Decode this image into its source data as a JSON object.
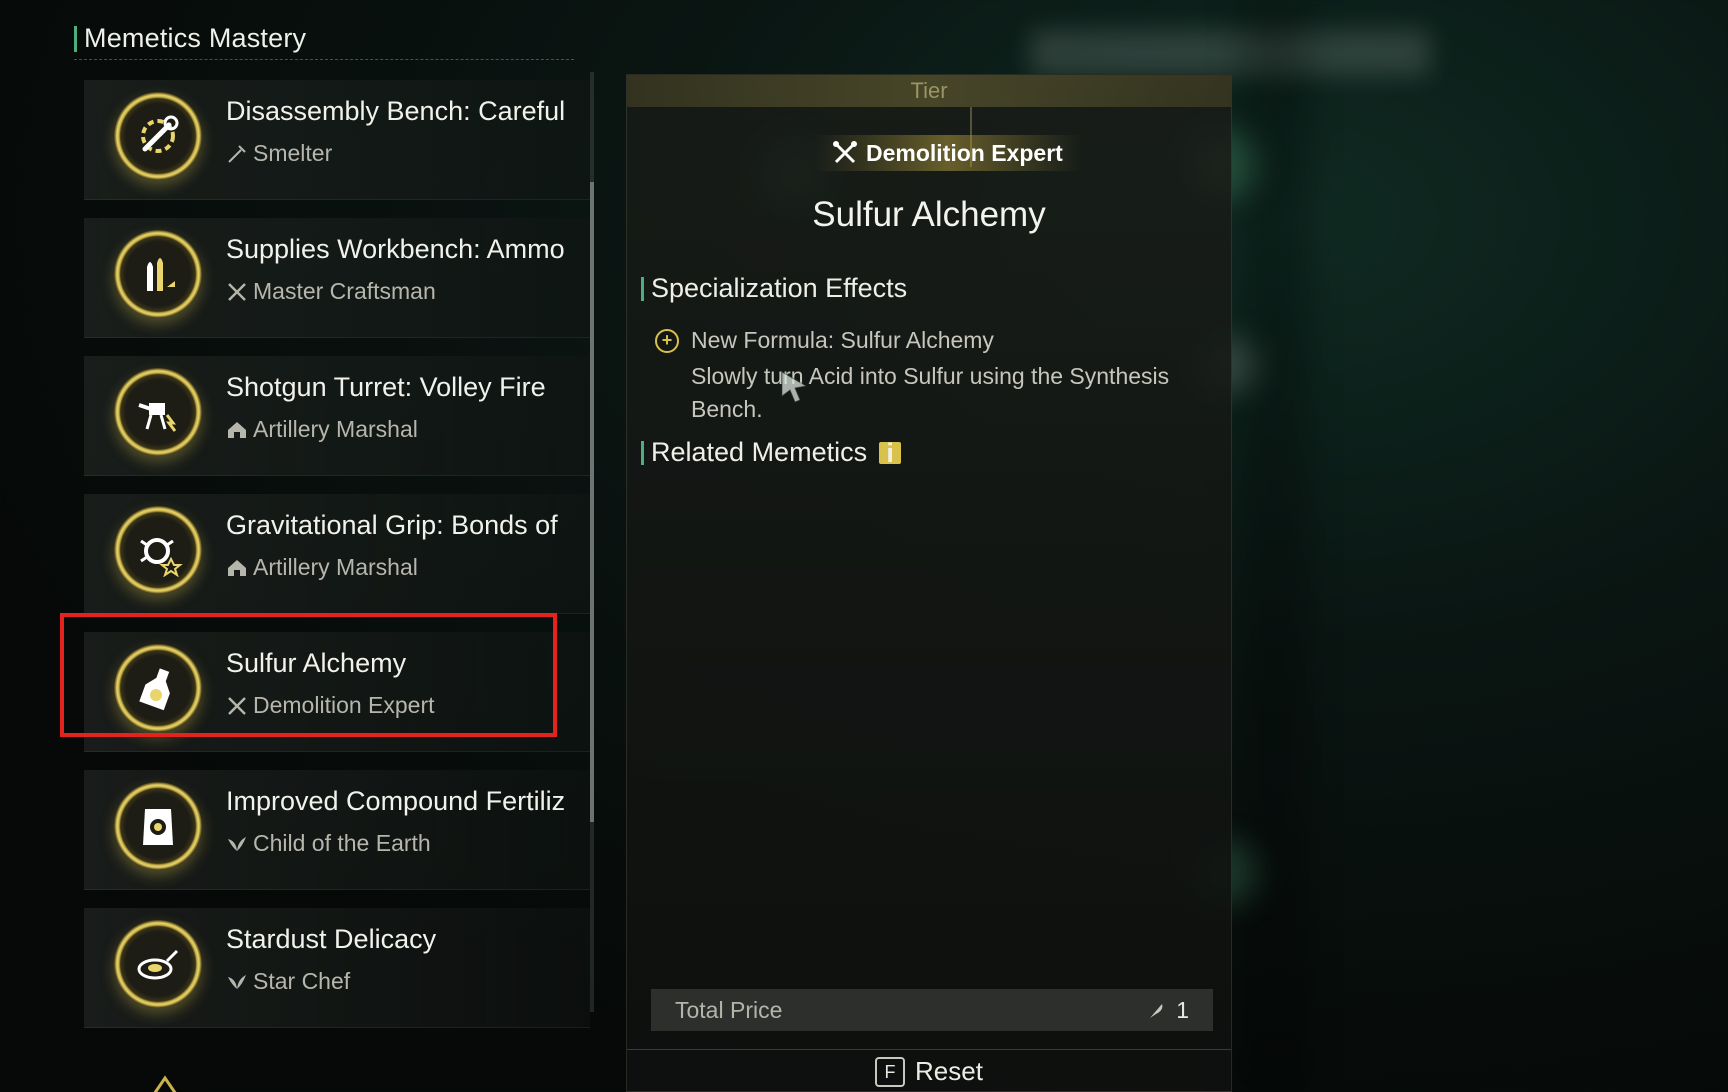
{
  "left_panel": {
    "title": "Memetics Mastery",
    "items": [
      {
        "name": "Disassembly Bench: Careful",
        "specialization": "Smelter",
        "sub_icon": "hammer-icon",
        "badge_icon": "wrench-gear-icon"
      },
      {
        "name": "Supplies Workbench: Ammo",
        "specialization": "Master Craftsman",
        "sub_icon": "crossed-tools-icon",
        "badge_icon": "bullets-icon"
      },
      {
        "name": "Shotgun Turret: Volley Fire",
        "specialization": "Artillery Marshal",
        "sub_icon": "house-icon",
        "badge_icon": "turret-icon"
      },
      {
        "name": "Gravitational Grip: Bonds of",
        "specialization": "Artillery Marshal",
        "sub_icon": "house-icon",
        "badge_icon": "grip-icon"
      },
      {
        "name": "Sulfur Alchemy",
        "specialization": "Demolition Expert",
        "sub_icon": "crossed-tools-icon",
        "badge_icon": "flask-icon"
      },
      {
        "name": "Improved Compound Fertiliz",
        "specialization": "Child of the Earth",
        "sub_icon": "leaf-icon",
        "badge_icon": "fertilizer-bag-icon"
      },
      {
        "name": "Stardust Delicacy",
        "specialization": "Star Chef",
        "sub_icon": "leaf-icon",
        "badge_icon": "frying-pan-icon"
      }
    ]
  },
  "detail": {
    "tier_label": "Tier",
    "specialization": "Demolition Expert",
    "title": "Sulfur Alchemy",
    "effects_heading": "Specialization Effects",
    "effect_title": "New Formula: Sulfur Alchemy",
    "effect_desc": "Slowly turn Acid into Sulfur using the Synthesis Bench.",
    "related_heading": "Related Memetics",
    "info_glyph": "i",
    "price_label": "Total Price",
    "price_value": "1",
    "reset_key": "F",
    "reset_label": "Reset"
  },
  "colors": {
    "accent_green": "#4caf7d",
    "gold": "#d8c24c",
    "highlight_red": "#e4221e"
  }
}
